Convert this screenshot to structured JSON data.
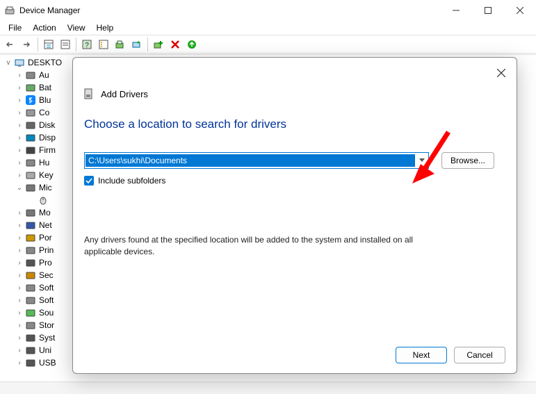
{
  "window": {
    "title": "Device Manager",
    "menu": {
      "file": "File",
      "action": "Action",
      "view": "View",
      "help": "Help"
    }
  },
  "tree": {
    "root": "DESKTO",
    "items": [
      {
        "exp": ">",
        "label": "Au",
        "iconColor": "#888"
      },
      {
        "exp": ">",
        "label": "Bat",
        "iconColor": "#6a6"
      },
      {
        "exp": ">",
        "label": "Blu",
        "iconColor": "#08f",
        "bt": true
      },
      {
        "exp": ">",
        "label": "Co",
        "iconColor": "#999"
      },
      {
        "exp": ">",
        "label": "Disk",
        "iconColor": "#666"
      },
      {
        "exp": ">",
        "label": "Disp",
        "iconColor": "#08b"
      },
      {
        "exp": ">",
        "label": "Firm",
        "iconColor": "#444"
      },
      {
        "exp": ">",
        "label": "Hu",
        "iconColor": "#888"
      },
      {
        "exp": ">",
        "label": "Key",
        "iconColor": "#aaa"
      },
      {
        "exp": "v",
        "label": "Mic",
        "iconColor": "#777",
        "child": ""
      },
      {
        "exp": ">",
        "label": "Mo",
        "iconColor": "#777"
      },
      {
        "exp": ">",
        "label": "Net",
        "iconColor": "#35a"
      },
      {
        "exp": ">",
        "label": "Por",
        "iconColor": "#c90"
      },
      {
        "exp": ">",
        "label": "Prin",
        "iconColor": "#888"
      },
      {
        "exp": ">",
        "label": "Pro",
        "iconColor": "#555"
      },
      {
        "exp": ">",
        "label": "Sec",
        "iconColor": "#c80"
      },
      {
        "exp": ">",
        "label": "Soft",
        "iconColor": "#888"
      },
      {
        "exp": ">",
        "label": "Soft",
        "iconColor": "#888"
      },
      {
        "exp": ">",
        "label": "Sou",
        "iconColor": "#5b5"
      },
      {
        "exp": ">",
        "label": "Stor",
        "iconColor": "#888"
      },
      {
        "exp": ">",
        "label": "Syst",
        "iconColor": "#555"
      },
      {
        "exp": ">",
        "label": "Uni",
        "iconColor": "#555"
      },
      {
        "exp": ">",
        "label": "USB",
        "iconColor": "#555"
      }
    ]
  },
  "dialog": {
    "header": "Add Drivers",
    "title": "Choose a location to search for drivers",
    "path": "C:\\Users\\sukhi\\Documents",
    "browse": "Browse...",
    "include_subfolders": "Include subfolders",
    "note": "Any drivers found at the specified location will be added to the system and installed on all applicable devices.",
    "next": "Next",
    "cancel": "Cancel"
  }
}
